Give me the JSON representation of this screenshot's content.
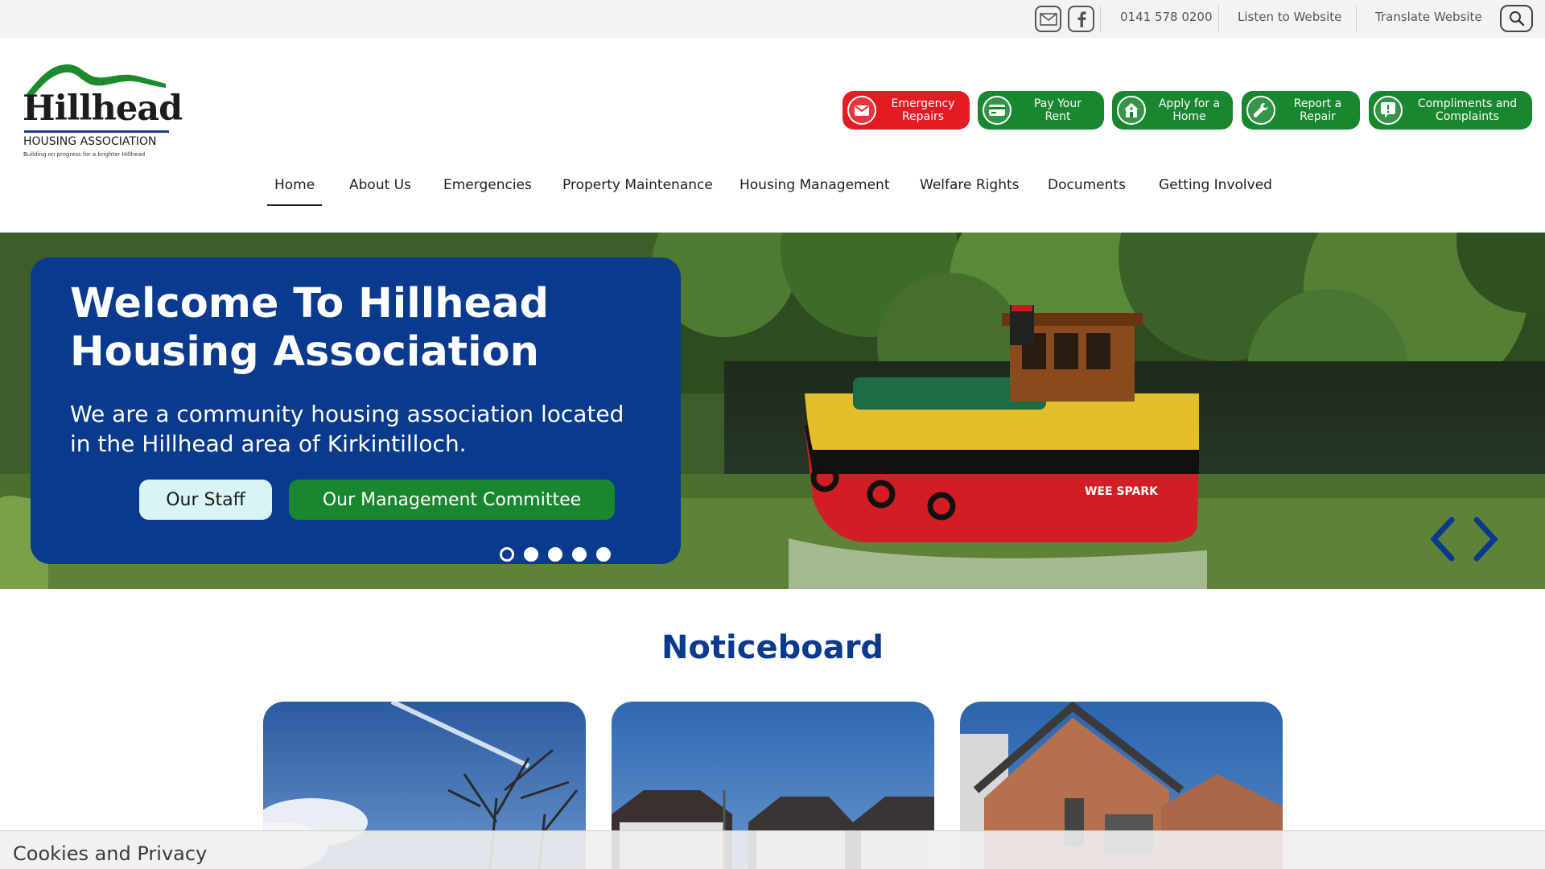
{
  "topbar": {
    "email_icon": "envelope-icon",
    "facebook_icon": "facebook-icon",
    "phone": "0141 578 0200",
    "listen": "Listen to Website",
    "translate": "Translate Website",
    "search_icon": "magnifier-icon"
  },
  "logo": {
    "name": "Hillhead",
    "subtitle": "HOUSING ASSOCIATION",
    "tagline": "Building on progress for a brighter Hillhead",
    "colors": {
      "green": "#1e8a2e",
      "blue": "#1a3c8c"
    }
  },
  "quick_actions": [
    {
      "label": "Emergency\nRepairs",
      "icon": "envelope-icon",
      "color": "#e41b23"
    },
    {
      "label": "Pay Your\nRent",
      "icon": "card-icon",
      "color": "#19872f"
    },
    {
      "label": "Apply for a\nHome",
      "icon": "house-icon",
      "color": "#19872f"
    },
    {
      "label": "Report a\nRepair",
      "icon": "wrench-icon",
      "color": "#19872f"
    },
    {
      "label": "Compliments and\nComplaints",
      "icon": "speech-exclaim-icon",
      "color": "#19872f"
    }
  ],
  "nav": {
    "items": [
      "Home",
      "About Us",
      "Emergencies",
      "Property Maintenance",
      "Housing Management",
      "Welfare Rights",
      "Documents",
      "Getting Involved"
    ],
    "active": "Home"
  },
  "hero": {
    "title": "Welcome To Hillhead Housing Association",
    "text": "We are a community housing association located in the Hillhead area of Kirkintilloch.",
    "buttons": {
      "staff": "Our Staff",
      "committee": "Our Management Committee"
    },
    "boat_name": "WEE SPARK",
    "slides_total": 5,
    "active_slide": 1,
    "colors": {
      "card": "#0a3a8d",
      "staff_btn": "#d9f4f4",
      "committee_btn": "#19872f",
      "arrow": "#0a3a8d"
    }
  },
  "noticeboard": {
    "title": "Noticeboard"
  },
  "cookie": {
    "title": "Cookies and Privacy"
  }
}
